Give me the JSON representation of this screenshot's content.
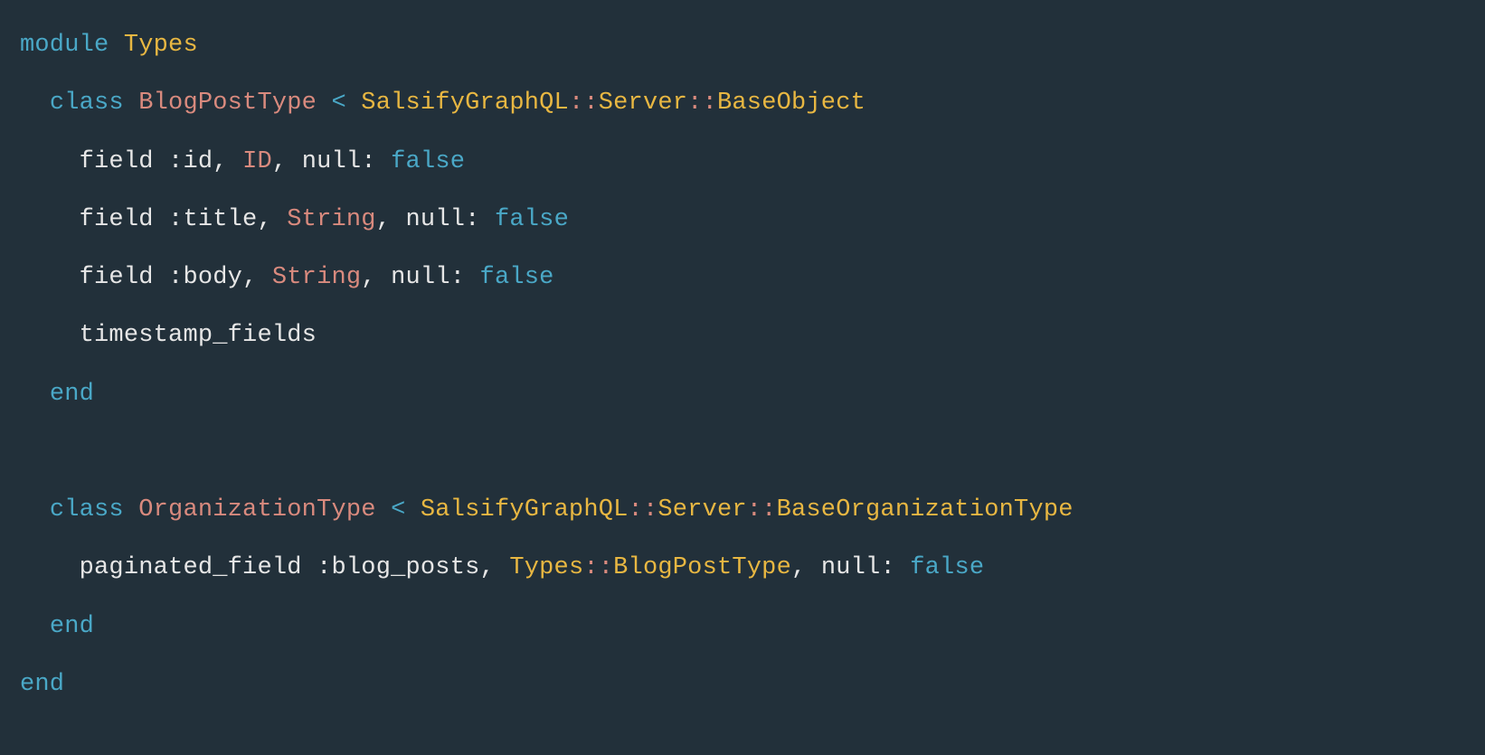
{
  "kw_module": "module",
  "kw_class": "class",
  "kw_end": "end",
  "kw_null": "null",
  "kw_false": "false",
  "op_lt": "<",
  "sep_dcolon": "::",
  "punc_comma": ",",
  "punc_colon": ":",
  "const_Types": "Types",
  "const_SalsifyGraphQL": "SalsifyGraphQL",
  "const_Server": "Server",
  "const_BaseObject": "BaseObject",
  "const_BaseOrganizationType": "BaseOrganizationType",
  "cname_BlogPostType": "BlogPostType",
  "cname_OrganizationType": "OrganizationType",
  "cname_ID": "ID",
  "cname_String": "String",
  "id_field": "field",
  "id_paginated_field": "paginated_field",
  "id_timestamp_fields": "timestamp_fields",
  "sym_id": ":id",
  "sym_title": ":title",
  "sym_body": ":body",
  "sym_blog_posts": ":blog_posts"
}
